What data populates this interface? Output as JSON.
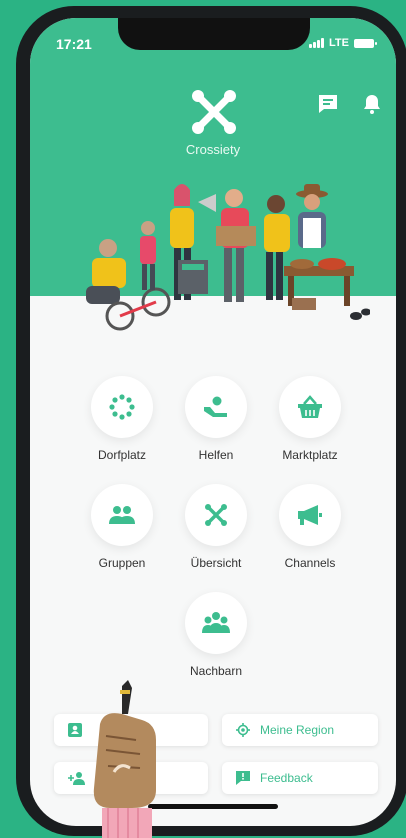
{
  "status_bar": {
    "time": "17:21",
    "network": "LTE"
  },
  "app": {
    "name": "Crossiety"
  },
  "colors": {
    "brand": "#3dbd8f",
    "background": "#2bb384",
    "text": "#333333"
  },
  "header_icons": [
    {
      "name": "chat-icon"
    },
    {
      "name": "bell-icon"
    }
  ],
  "menu": {
    "items": [
      {
        "label": "Dorfplatz",
        "icon": "dots-circle-icon"
      },
      {
        "label": "Helfen",
        "icon": "helping-hand-icon"
      },
      {
        "label": "Marktplatz",
        "icon": "basket-icon"
      },
      {
        "label": "Gruppen",
        "icon": "group-icon"
      },
      {
        "label": "Übersicht",
        "icon": "crossiety-icon"
      },
      {
        "label": "Channels",
        "icon": "megaphone-icon"
      },
      {
        "label": "Nachbarn",
        "icon": "neighbors-icon"
      }
    ]
  },
  "bottom_buttons": {
    "region_label": "Meine Region",
    "feedback_label": "Feedback"
  }
}
